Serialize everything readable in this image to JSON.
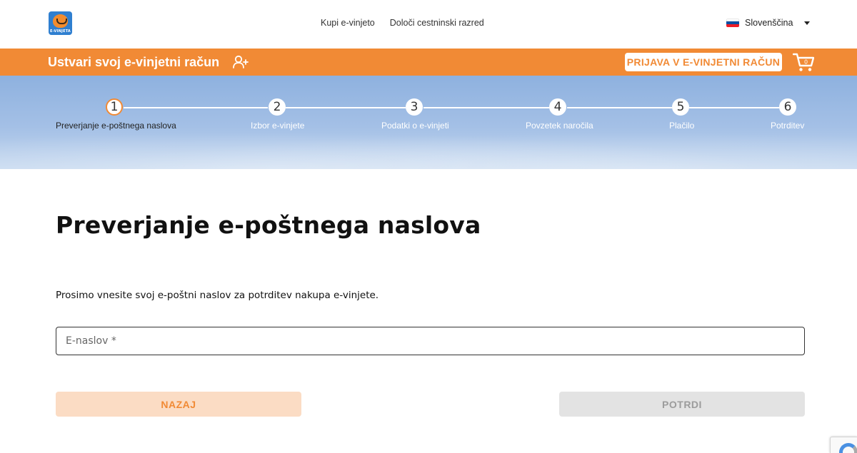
{
  "header": {
    "logo_text": "E-VINJETA",
    "nav": [
      {
        "label": "Kupi e-vinjeto"
      },
      {
        "label": "Določi cestninski razred"
      }
    ],
    "language": {
      "selected": "Slovenščina"
    }
  },
  "account_bar": {
    "title": "Ustvari svoj e-vinjetni račun",
    "login_label": "PRIJAVA V E-VINJETNI RAČUN",
    "cart_count": "0"
  },
  "steps": [
    {
      "number": "1",
      "label": "Preverjanje e-poštnega naslova",
      "active": true
    },
    {
      "number": "2",
      "label": "Izbor e-vinjete",
      "active": false
    },
    {
      "number": "3",
      "label": "Podatki o e-vinjeti",
      "active": false
    },
    {
      "number": "4",
      "label": "Povzetek naročila",
      "active": false
    },
    {
      "number": "5",
      "label": "Plačilo",
      "active": false
    },
    {
      "number": "6",
      "label": "Potrditev",
      "active": false
    }
  ],
  "main": {
    "title": "Preverjanje e-poštnega naslova",
    "intro": "Prosimo vnesite svoj e-poštni naslov za potrditev nakupa e-vinjete.",
    "email_placeholder": "E-naslov *",
    "email_value": "",
    "back_label": "NAZAJ",
    "confirm_label": "POTRDI"
  },
  "colors": {
    "accent": "#f18a35",
    "back_button_bg": "#fbdcc4",
    "disabled_button_bg": "#e3e3e3"
  }
}
